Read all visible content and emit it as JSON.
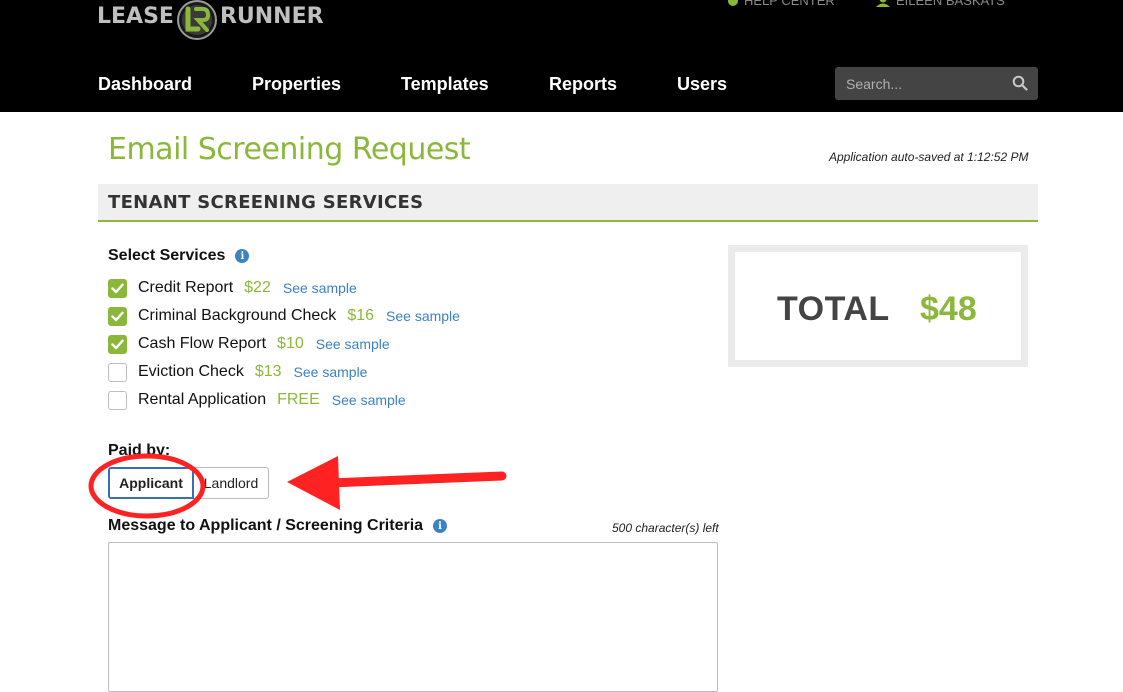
{
  "header": {
    "logo_left": "LEASE",
    "logo_right": "RUNNER",
    "help_center": "HELP CENTER",
    "user_name": "EILEEN BASKATS",
    "nav": [
      "Dashboard",
      "Properties",
      "Templates",
      "Reports",
      "Users"
    ],
    "search_placeholder": "Search..."
  },
  "page": {
    "title": "Email Screening Request",
    "autosave": "Application auto-saved at 1:12:52 PM",
    "section_title": "TENANT SCREENING SERVICES"
  },
  "services": {
    "label": "Select Services",
    "items": [
      {
        "name": "Credit Report",
        "price": "$22",
        "sample": "See sample",
        "checked": true
      },
      {
        "name": "Criminal Background Check",
        "price": "$16",
        "sample": "See sample",
        "checked": true
      },
      {
        "name": "Cash Flow Report",
        "price": "$10",
        "sample": "See sample",
        "checked": true
      },
      {
        "name": "Eviction Check",
        "price": "$13",
        "sample": "See sample",
        "checked": false
      },
      {
        "name": "Rental Application",
        "price": "FREE",
        "sample": "See sample",
        "checked": false
      }
    ]
  },
  "paid_by": {
    "label": "Paid by:",
    "applicant": "Applicant",
    "landlord": "Landlord",
    "selected": "Applicant"
  },
  "message": {
    "label": "Message to Applicant / Screening Criteria",
    "chars_left": "500 character(s) left",
    "value": ""
  },
  "total": {
    "label": "TOTAL",
    "value": "$48"
  },
  "colors": {
    "accent": "#8bb83a",
    "link": "#3b82c4",
    "annotation": "#ff2222"
  }
}
